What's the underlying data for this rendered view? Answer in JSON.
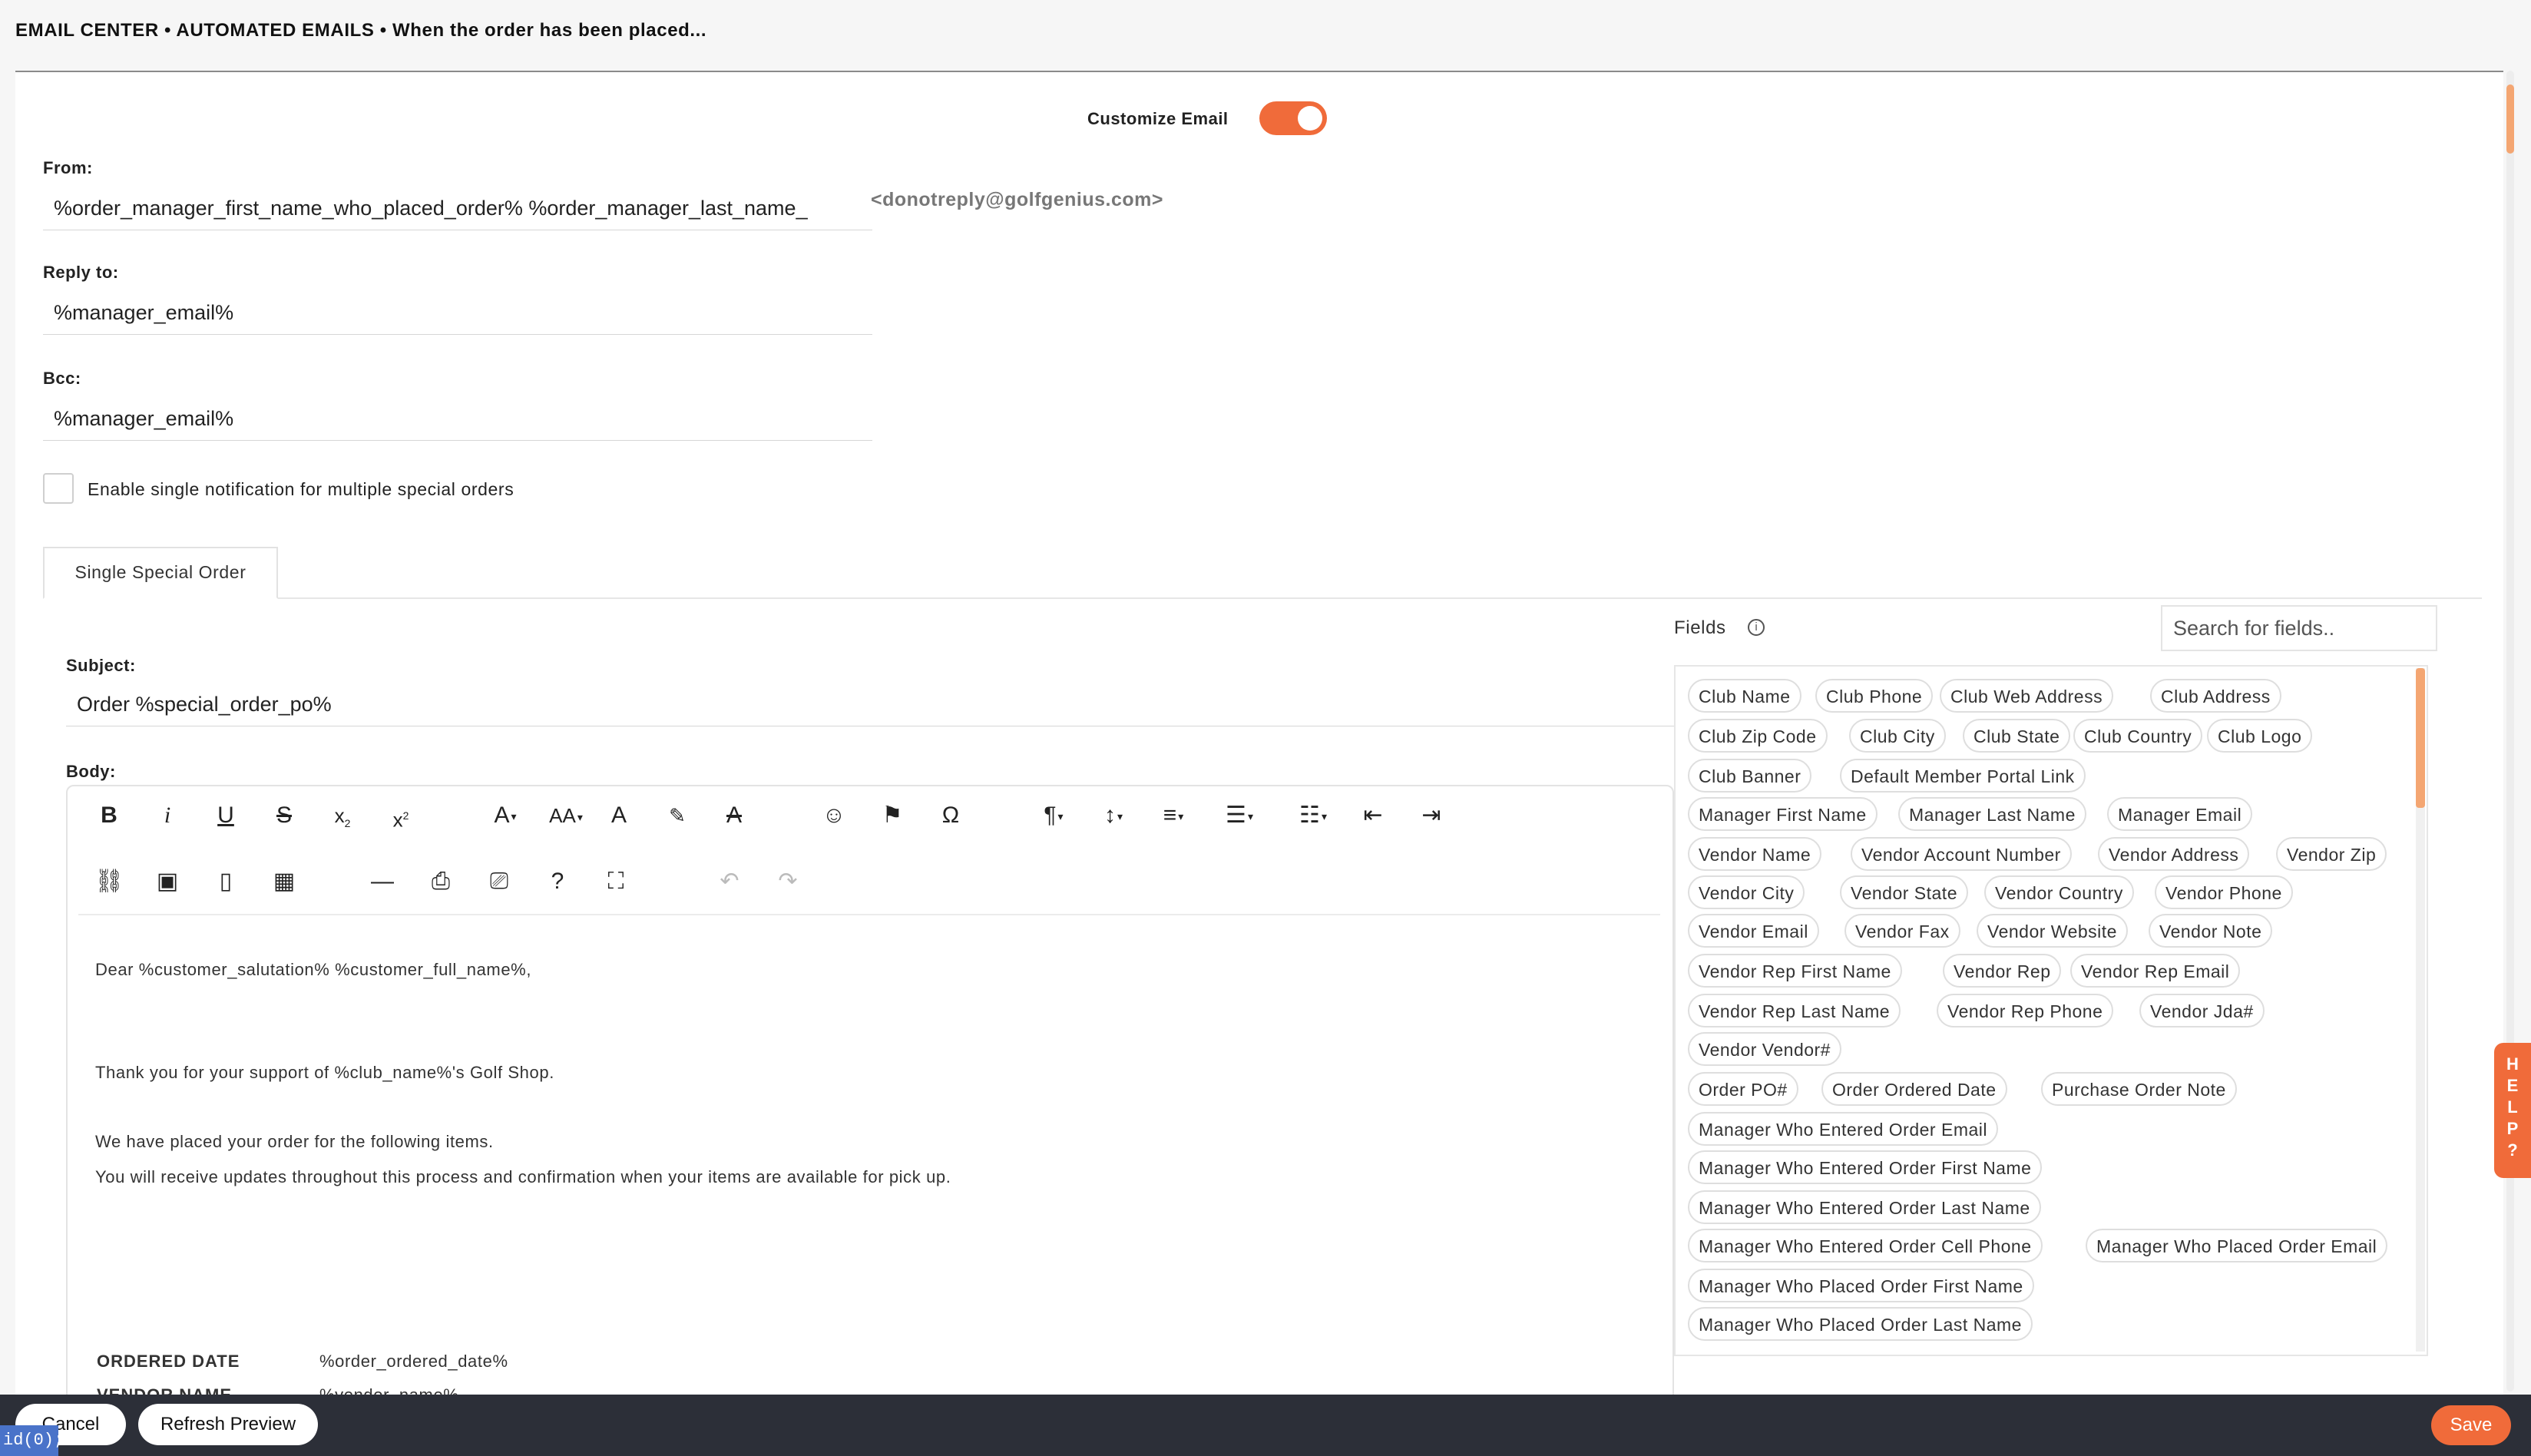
{
  "breadcrumb": "EMAIL CENTER • AUTOMATED EMAILS • When the order has been placed...",
  "customize": {
    "label": "Customize Email",
    "enabled": true
  },
  "from": {
    "label": "From:",
    "value": "%order_manager_first_name_who_placed_order% %order_manager_last_name_",
    "address": "<donotreply@golfgenius.com>"
  },
  "reply_to": {
    "label": "Reply to:",
    "value": "%manager_email%"
  },
  "bcc": {
    "label": "Bcc:",
    "value": "%manager_email%"
  },
  "single_notification": {
    "label": "Enable single notification for multiple special orders",
    "checked": false
  },
  "tabs": [
    "Single Special Order"
  ],
  "subject": {
    "label": "Subject:",
    "value": "Order %special_order_po%"
  },
  "body": {
    "label": "Body:",
    "lines": [
      "Dear %customer_salutation% %customer_full_name%,",
      "Thank you for your support of %club_name%'s Golf Shop.",
      "We have placed your order for the following items.",
      "You will receive updates throughout this process and confirmation when your items are available for pick up."
    ],
    "details": [
      {
        "key": "ORDERED DATE",
        "value": "%order_ordered_date%"
      },
      {
        "key": "VENDOR NAME",
        "value": "%vendor_name%"
      }
    ]
  },
  "toolbar": {
    "row1": [
      "bold-icon",
      "italic-icon",
      "underline-icon",
      "strikethrough-icon",
      "subscript-icon",
      "superscript-icon",
      "font-family-icon",
      "font-size-icon",
      "text-color-icon",
      "highlight-icon",
      "clear-format-icon",
      "emoji-icon",
      "flag-icon",
      "special-char-icon",
      "paragraph-icon",
      "line-height-icon",
      "align-icon",
      "ordered-list-icon",
      "unordered-list-icon",
      "outdent-icon",
      "indent-icon"
    ],
    "row2": [
      "link-icon",
      "image-icon",
      "file-icon",
      "table-icon",
      "hr-icon",
      "pdf-icon",
      "print-icon",
      "help-icon",
      "fullscreen-icon",
      "undo-icon",
      "redo-icon"
    ]
  },
  "fields_panel": {
    "title": "Fields",
    "search_placeholder": "Search for fields..",
    "chips": [
      "Club Name",
      "Club Phone",
      "Club Web Address",
      "Club Address",
      "Club Zip Code",
      "Club City",
      "Club State",
      "Club Country",
      "Club Logo",
      "Club Banner",
      "Default Member Portal Link",
      "Manager First Name",
      "Manager Last Name",
      "Manager Email",
      "Vendor Name",
      "Vendor Account Number",
      "Vendor Address",
      "Vendor Zip",
      "Vendor City",
      "Vendor State",
      "Vendor Country",
      "Vendor Phone",
      "Vendor Email",
      "Vendor Fax",
      "Vendor Website",
      "Vendor Note",
      "Vendor Rep First Name",
      "Vendor Rep",
      "Vendor Rep Email",
      "Vendor Rep Last Name",
      "Vendor Rep Phone",
      "Vendor Jda#",
      "Vendor Vendor#",
      "Order PO#",
      "Order Ordered Date",
      "Purchase Order Note",
      "Manager Who Entered Order Email",
      "Manager Who Entered Order First Name",
      "Manager Who Entered Order Last Name",
      "Manager Who Entered Order Cell Phone",
      "Manager Who Placed Order Email",
      "Manager Who Placed Order First Name",
      "Manager Who Placed Order Last Name"
    ]
  },
  "help_tab": "HELP",
  "footer": {
    "cancel": "Cancel",
    "refresh": "Refresh Preview",
    "save": "Save",
    "status": "id(0);"
  },
  "colors": {
    "accent": "#f06b3a",
    "footer": "#2c2f38"
  }
}
